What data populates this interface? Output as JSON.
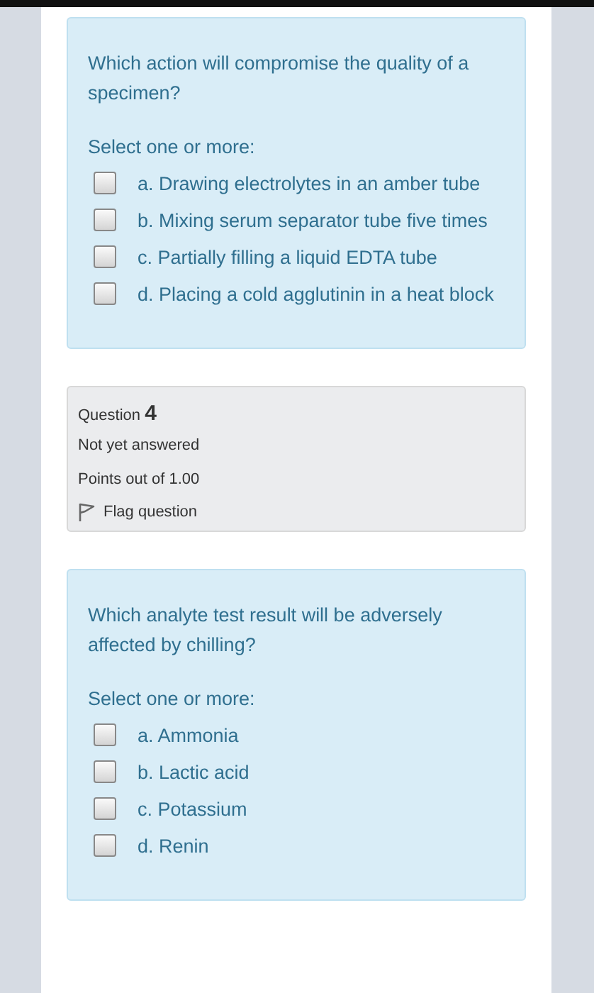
{
  "questions": [
    {
      "kind": "formulation",
      "text": "Which action will compromise the quality of a specimen?",
      "prompt": "Select one or more:",
      "options": [
        {
          "label": "a. Drawing electrolytes in an amber tube",
          "checked": false
        },
        {
          "label": "b. Mixing serum separator tube five times",
          "checked": false
        },
        {
          "label": "c. Partially filling a liquid EDTA tube",
          "checked": false
        },
        {
          "label": "d. Placing a cold agglutinin in a heat block",
          "checked": false
        }
      ]
    },
    {
      "kind": "info",
      "label": "Question",
      "number": "4",
      "status": "Not yet answered",
      "points": "Points out of 1.00",
      "flag": "Flag question"
    },
    {
      "kind": "formulation",
      "text": "Which analyte test result will be adversely affected by chilling?",
      "prompt": "Select one or more:",
      "options": [
        {
          "label": "a. Ammonia",
          "checked": false
        },
        {
          "label": "b. Lactic acid",
          "checked": false
        },
        {
          "label": "c. Potassium",
          "checked": false
        },
        {
          "label": "d. Renin",
          "checked": false
        }
      ]
    }
  ]
}
